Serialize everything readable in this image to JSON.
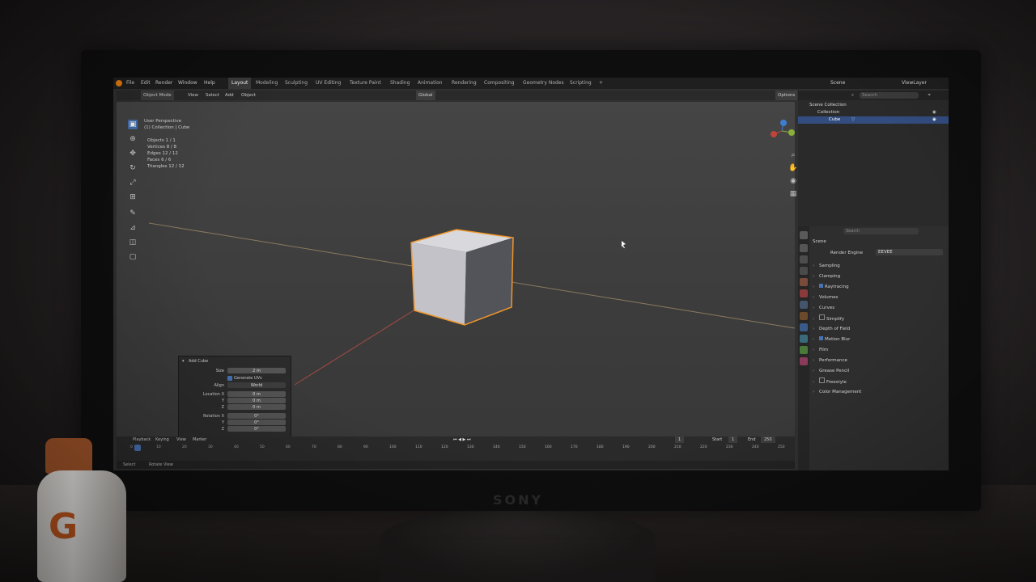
{
  "topbar": {
    "menus": [
      "File",
      "Edit",
      "Render",
      "Window",
      "Help"
    ],
    "workspaces": [
      "Layout",
      "Modeling",
      "Sculpting",
      "UV Editing",
      "Texture Paint",
      "Shading",
      "Animation",
      "Rendering",
      "Compositing",
      "Geometry Nodes",
      "Scripting"
    ],
    "active_workspace": "Layout",
    "add_tab": "+",
    "scene_label": "Scene",
    "view_layer_label": "ViewLayer"
  },
  "viewport_header": {
    "mode": "Object Mode",
    "menus": [
      "View",
      "Select",
      "Add",
      "Object"
    ],
    "orientation": "Global",
    "options": "Options"
  },
  "viewport": {
    "perspective_label": "User Perspective",
    "collection_label": "(1) Collection | Cube",
    "stats": [
      {
        "label": "Objects",
        "value": "1 / 1"
      },
      {
        "label": "Vertices",
        "value": "8 / 8"
      },
      {
        "label": "Edges",
        "value": "12 / 12"
      },
      {
        "label": "Faces",
        "value": "6 / 6"
      },
      {
        "label": "Triangles",
        "value": "12 / 12"
      }
    ]
  },
  "operator_panel": {
    "title": "Add Cube",
    "rows": [
      {
        "label": "Size",
        "value": "2 m"
      },
      {
        "label": "",
        "value": "Generate UVs"
      },
      {
        "label": "Align",
        "value": "World"
      },
      {
        "label": "Location X",
        "value": "0 m"
      },
      {
        "label": "Y",
        "value": "0 m"
      },
      {
        "label": "Z",
        "value": "0 m"
      },
      {
        "label": "Rotation X",
        "value": "0°"
      },
      {
        "label": "Y",
        "value": "0°"
      },
      {
        "label": "Z",
        "value": "0°"
      }
    ]
  },
  "timeline": {
    "menus": [
      "Playback",
      "Keying",
      "View",
      "Marker"
    ],
    "current_frame": "1",
    "start_label": "Start",
    "start_value": "1",
    "end_label": "End",
    "end_value": "250",
    "ticks": [
      "0",
      "10",
      "20",
      "30",
      "40",
      "50",
      "60",
      "70",
      "80",
      "90",
      "100",
      "110",
      "120",
      "130",
      "140",
      "150",
      "160",
      "170",
      "180",
      "190",
      "200",
      "210",
      "220",
      "230",
      "240",
      "250"
    ]
  },
  "statusbar": {
    "items": [
      "Select",
      "Rotate View"
    ]
  },
  "outliner": {
    "search_placeholder": "Search",
    "rows": [
      "Scene Collection",
      "Collection",
      "Cube"
    ],
    "selected_row": "Cube"
  },
  "properties": {
    "search_placeholder": "Search",
    "breadcrumb": "Scene",
    "render_engine_label": "Render Engine",
    "render_engine_value": "EEVEE",
    "sections": [
      "Sampling",
      "Clamping",
      "Raytracing",
      "Volumes",
      "Curves",
      "Simplify",
      "Depth of Field",
      "Motion Blur",
      "Film",
      "Performance",
      "Grease Pencil",
      "Freestyle",
      "Color Management"
    ]
  },
  "colors": {
    "accent": "#4772b3",
    "selection_outline": "#f0962a",
    "x_axis": "#c0443a",
    "y_axis": "#8bb03a",
    "z_axis": "#3d7ed1"
  },
  "room": {
    "monitor_brand": "SONY",
    "bottle_logo": "G"
  }
}
